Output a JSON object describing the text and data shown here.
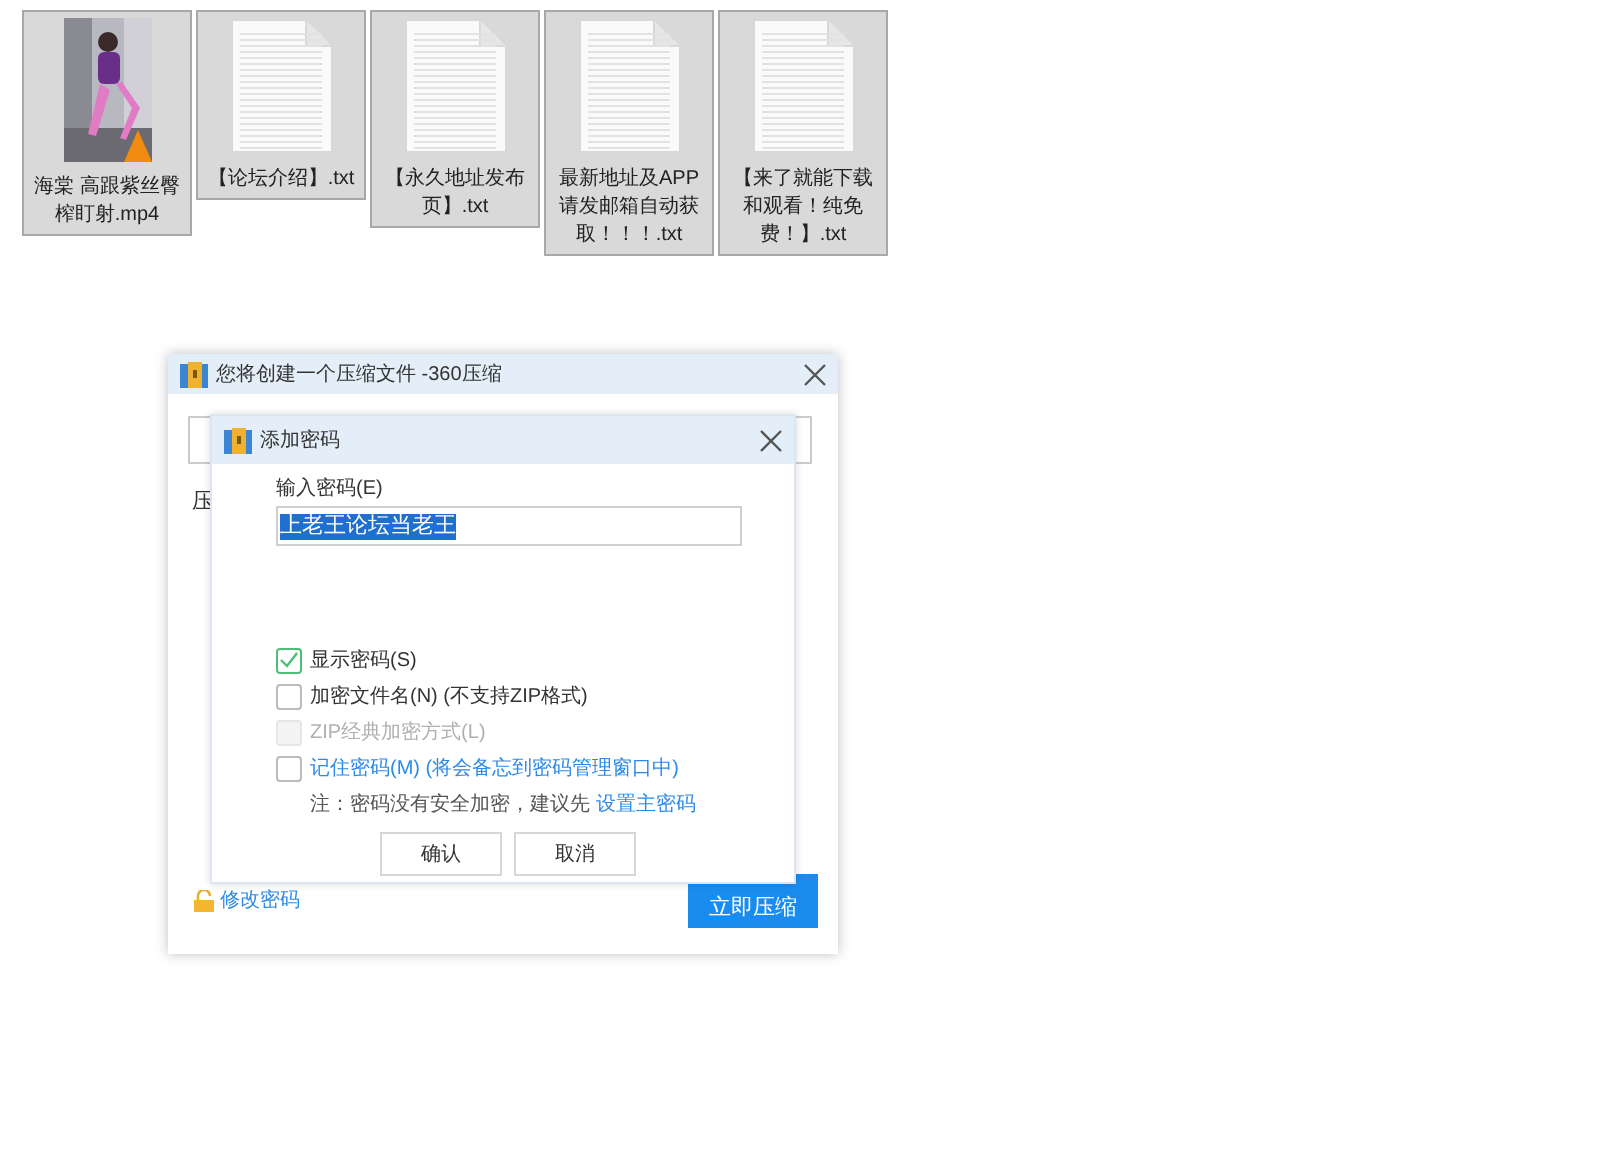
{
  "files": [
    {
      "kind": "video",
      "name": "海棠 高跟紫丝臀榨盯射.mp4",
      "selected": true
    },
    {
      "kind": "text",
      "name": "【论坛介绍】.txt",
      "selected": true
    },
    {
      "kind": "text",
      "name": "【永久地址发布页】.txt",
      "selected": true
    },
    {
      "kind": "text",
      "name": "最新地址及APP请发邮箱自动获取！！！.txt",
      "selected": true
    },
    {
      "kind": "text",
      "name": "【来了就能下载和观看！纯免费！】.txt",
      "selected": true
    }
  ],
  "main_dialog": {
    "title": "您将创建一个压缩文件 -360压缩",
    "label": "压",
    "change_password_link": "修改密码",
    "compress_button": "立即压缩"
  },
  "password_dialog": {
    "title": "添加密码",
    "password_label": "输入密码(E)",
    "password_value": "上老王论坛当老王",
    "options": [
      {
        "label": "显示密码(S)",
        "checked": true,
        "disabled": false,
        "link": false
      },
      {
        "label": "加密文件名(N) (不支持ZIP格式)",
        "checked": false,
        "disabled": false,
        "link": false
      },
      {
        "label": "ZIP经典加密方式(L)",
        "checked": false,
        "disabled": true,
        "link": false
      },
      {
        "label": "记住密码(M) (将会备忘到密码管理窗口中)",
        "checked": false,
        "disabled": false,
        "link": true
      }
    ],
    "note": "注：密码没有安全加密，建议先",
    "note_link": "设置主密码",
    "ok_button": "确认",
    "cancel_button": "取消"
  }
}
